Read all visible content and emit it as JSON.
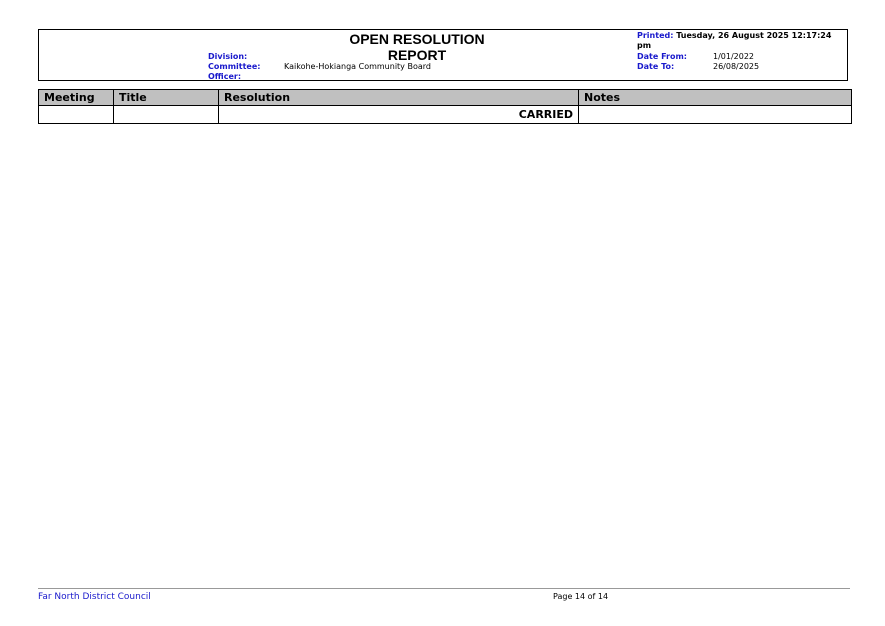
{
  "report": {
    "title": "OPEN RESOLUTION REPORT",
    "division_label": "Division:",
    "committee_label": "Committee:",
    "committee_value": "Kaikohe-Hokianga Community Board",
    "officer_label": "Officer:",
    "printed_label": "Printed:",
    "printed_value": "Tuesday, 26 August 2025  12:17:24 pm",
    "date_from_label": "Date From:",
    "date_from_value": "1/01/2022",
    "date_to_label": "Date To:",
    "date_to_value": "26/08/2025"
  },
  "table": {
    "headers": [
      "Meeting",
      "Title",
      "Resolution",
      "Notes"
    ],
    "rows": [
      {
        "meeting": "",
        "title": "",
        "resolution": "CARRIED",
        "notes": ""
      }
    ]
  },
  "footer": {
    "organisation": "Far North District Council",
    "page_text": "Page 14 of 14"
  }
}
